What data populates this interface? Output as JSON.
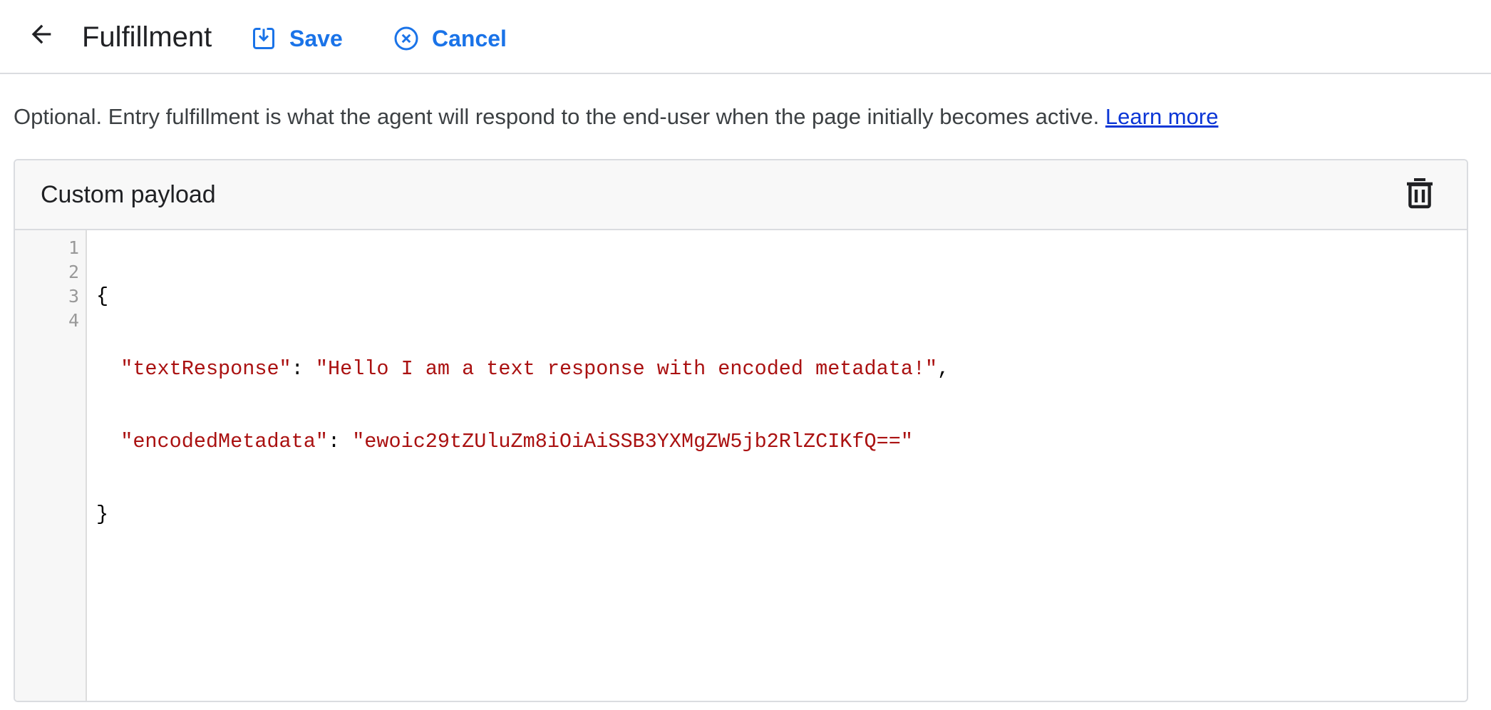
{
  "header": {
    "title": "Fulfillment",
    "back_icon": "arrow-back-icon",
    "save_label": "Save",
    "save_icon": "save-download-icon",
    "cancel_label": "Cancel",
    "cancel_icon": "cancel-circle-x-icon"
  },
  "description": {
    "text": "Optional. Entry fulfillment is what the agent will respond to the end-user when the page initially becomes active.",
    "link_label": "Learn more"
  },
  "payload_card": {
    "title": "Custom payload",
    "delete_icon": "trash-icon",
    "editor": {
      "line_numbers": [
        "1",
        "2",
        "3",
        "4"
      ],
      "lines": {
        "l1": "{",
        "l2_key": "\"textResponse\"",
        "l2_sep": ": ",
        "l2_value": "\"Hello I am a text response with encoded metadata!\"",
        "l2_end": ",",
        "l3_key": "\"encodedMetadata\"",
        "l3_sep": ": ",
        "l3_value": "\"ewoic29tZUluZm8iOiAiSSB3YXMgZW5jb2RlZCIKfQ==\"",
        "l4": "}"
      }
    }
  },
  "colors": {
    "accent": "#1a73e8",
    "link": "#0b36d6",
    "string": "#aa1111",
    "divider": "#dadce0"
  }
}
